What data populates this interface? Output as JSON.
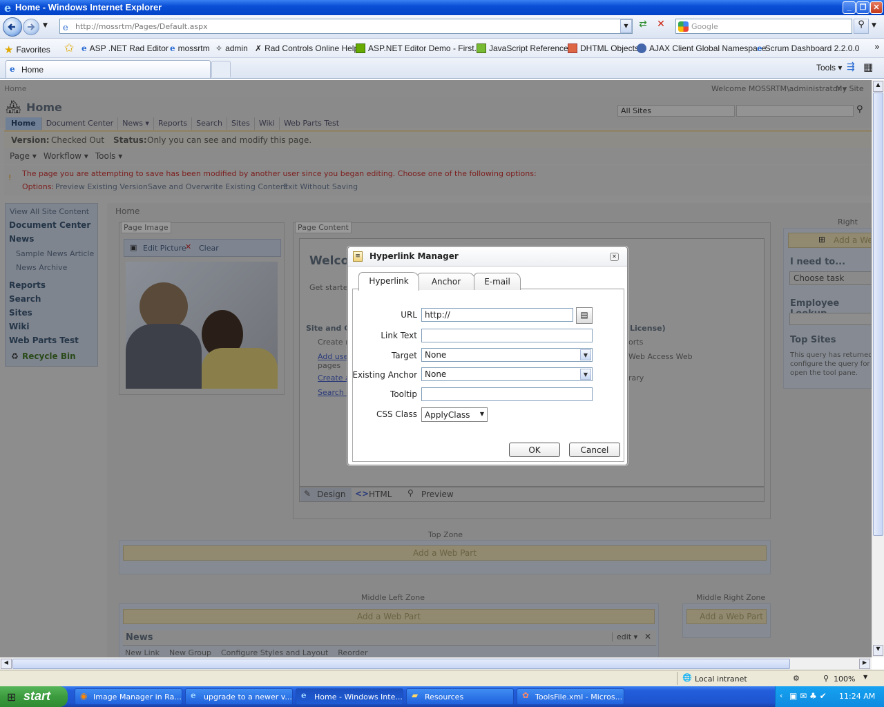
{
  "window": {
    "title": "Home - Windows Internet Explorer",
    "min": "_",
    "max": "❐",
    "close": "✕"
  },
  "nav": {
    "address": "http://mossrtm/Pages/Default.aspx",
    "search_placeholder": "Google"
  },
  "favorites": {
    "label": "Favorites",
    "items": [
      "ASP .NET Rad Editor",
      "mossrtm",
      "admin",
      "Rad Controls Online Help",
      "ASP.NET Editor Demo - First...",
      "JavaScript Reference",
      "DHTML Objects",
      "AJAX Client Global Namespace",
      "Scrum Dashboard 2.2.0.0"
    ]
  },
  "tabbar": {
    "tab": "Home",
    "tools": "Tools ▾"
  },
  "sp": {
    "crumb": "Home",
    "welcome": "Welcome MOSSRTM\\administrator ▾",
    "mysite": "My Site",
    "title": "Home",
    "scope": "All Sites",
    "topnav": [
      "Home",
      "Document Center",
      "News ▾",
      "Reports",
      "Search",
      "Sites",
      "Wiki",
      "Web Parts Test"
    ],
    "version_label": "Version:",
    "version": "Checked Out",
    "status_label": "Status:",
    "status": "Only you can see and modify this page.",
    "menus": [
      "Page ▾",
      "Workflow ▾",
      "Tools ▾"
    ],
    "warning": "The page you are attempting to save has been modified by another user since you began editing. Choose one of the following options:",
    "options_label": "Options:",
    "options": [
      "Preview Existing Version",
      "Save and Overwrite Existing Content",
      "Exit Without Saving"
    ],
    "quicklaunch": {
      "view_all": "View All Site Content",
      "doc_center": "Document Center",
      "news": "News",
      "news_items": [
        "Sample News Article",
        "News Archive"
      ],
      "sections": [
        "Reports",
        "Search",
        "Sites",
        "Wiki",
        "Web Parts Test"
      ],
      "recycle": "Recycle Bin"
    },
    "inner_crumb": "Home",
    "page_image": {
      "label": "Page Image",
      "edit": "Edit Picture",
      "clear": "Clear"
    },
    "page_content": {
      "label": "Page Content",
      "welcome": "Welcom",
      "get_started": "Get started",
      "site_and": "Site and Co",
      "license": "License)",
      "bullets": [
        "Create n",
        "Add user",
        "pages",
        "Create a",
        "Search o"
      ],
      "right_frag": [
        "orts",
        "Web Access Web",
        "rary"
      ]
    },
    "editor_modes": [
      "Design",
      "HTML",
      "Preview"
    ],
    "right_zone": {
      "label": "Right Zone",
      "add": "Add a We",
      "i_need": "I need to...",
      "choose": "Choose task",
      "employee": "Employee Lookup",
      "top_sites": "Top Sites",
      "top_sites_text": [
        "This query has returned",
        "configure the query for t",
        "open the tool pane."
      ]
    },
    "top_zone": {
      "label": "Top Zone",
      "add": "Add a Web Part"
    },
    "mid_left": {
      "label": "Middle Left Zone",
      "add": "Add a Web Part",
      "news": "News",
      "edit": "edit ▾",
      "toolbar": [
        "New Link",
        "New Group",
        "Configure Styles and Layout",
        "Reorder"
      ]
    },
    "mid_right": {
      "label": "Middle Right Zone",
      "add": "Add a Web Part"
    }
  },
  "dialog": {
    "title": "Hyperlink Manager",
    "tabs": [
      "Hyperlink",
      "Anchor",
      "E-mail"
    ],
    "url_label": "URL",
    "url": "http://",
    "linktext_label": "Link Text",
    "linktext": "",
    "target_label": "Target",
    "target": "None",
    "anchor_label": "Existing Anchor",
    "anchor": "None",
    "tooltip_label": "Tooltip",
    "tooltip": "",
    "css_label": "CSS Class",
    "css": "ApplyClass",
    "ok": "OK",
    "cancel": "Cancel"
  },
  "status": {
    "zone": "Local intranet",
    "zoom": "100%"
  },
  "taskbar": {
    "start": "start",
    "items": [
      "Image Manager in Ra...",
      "upgrade to a newer v...",
      "Home - Windows Inte...",
      "Resources",
      "ToolsFile.xml - Micros..."
    ],
    "clock": "11:24 AM"
  }
}
